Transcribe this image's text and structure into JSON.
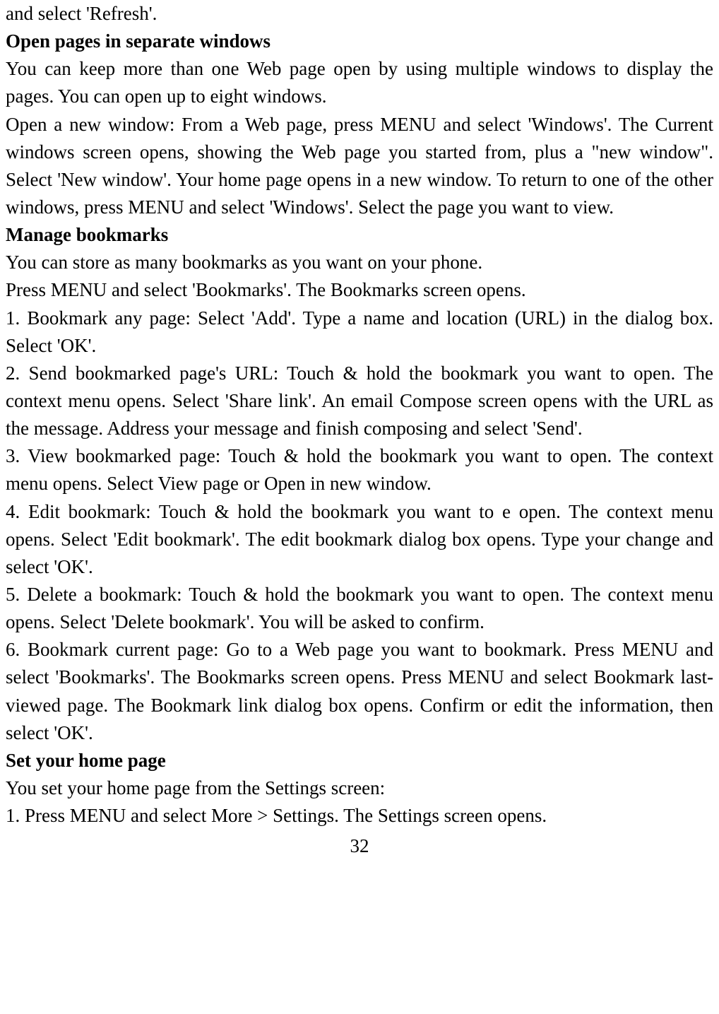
{
  "body": {
    "p1": "and select 'Refresh'.",
    "h1": "Open pages in separate windows",
    "p2": "You can keep more than one Web page open by using multiple windows to display the pages. You can open up to eight windows.",
    "p3": "Open a new window: From a Web page, press MENU and select 'Windows'. The Current windows screen opens, showing the Web page you started from, plus a \"new window\". Select 'New window'. Your home page opens in a new window. To return to one of the other windows, press MENU and select 'Windows'. Select the page you want to view.",
    "h2": "Manage bookmarks",
    "p4": "You can store as many bookmarks as you want on your phone.",
    "p5": "Press MENU and select 'Bookmarks'. The Bookmarks screen opens.",
    "p6": "1. Bookmark any page: Select 'Add'. Type a name and location (URL) in the dialog box. Select 'OK'.",
    "p7": "2. Send bookmarked page's URL: Touch & hold the bookmark you want to open. The context menu opens. Select 'Share link'. An email Compose screen opens with the URL as the message. Address your message and finish composing and select 'Send'.",
    "p8": "3. View bookmarked page: Touch & hold the bookmark you want to open. The context menu opens. Select View page or Open in new window.",
    "p9": "4. Edit bookmark: Touch & hold the bookmark you want to e open. The context menu opens. Select 'Edit bookmark'. The edit bookmark dialog box opens. Type your change and select 'OK'.",
    "p10": "5. Delete a bookmark: Touch & hold the bookmark you want to open. The context menu opens. Select 'Delete bookmark'. You will be asked to confirm.",
    "p11": "6. Bookmark current page: Go to a Web page you want to bookmark. Press MENU and select 'Bookmarks'. The Bookmarks screen opens. Press MENU and select Bookmark last-viewed page. The Bookmark link dialog box opens. Confirm or edit the information, then select 'OK'.",
    "h3": "Set your home page",
    "p12": "You set your home page from the Settings screen:",
    "p13": "1. Press MENU and select More > Settings. The Settings screen opens."
  },
  "pageNumber": "32"
}
